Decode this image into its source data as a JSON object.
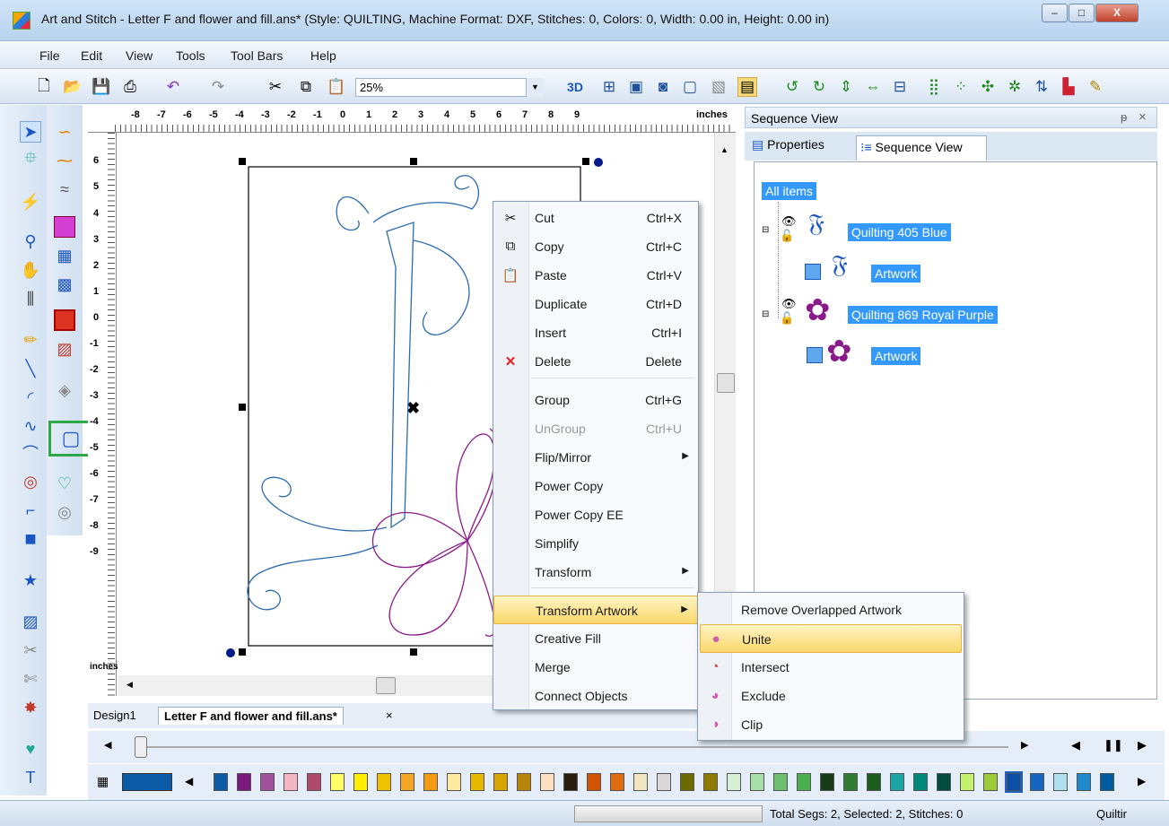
{
  "window": {
    "title": "Art and Stitch - Letter F and flower and fill.ans* (Style: QUILTING, Machine Format: DXF, Stitches: 0, Colors: 0, Width: 0.00 in, Height: 0.00 in)",
    "min": "–",
    "max": "□",
    "close": "X"
  },
  "menubar": [
    "File",
    "Edit",
    "View",
    "Tools",
    "Tool Bars",
    "Help"
  ],
  "toolbar": {
    "zoom": "25%",
    "icons": [
      "new-icon",
      "open-icon",
      "save-icon",
      "print-icon",
      "undo-icon",
      "redo-icon",
      "cut-icon",
      "copy-icon",
      "paste-icon"
    ],
    "btn_3d": "3D"
  },
  "ruler": {
    "top": [
      "-8",
      "-7",
      "-6",
      "-5",
      "-4",
      "-3",
      "-2",
      "-1",
      "0",
      "1",
      "2",
      "3",
      "4",
      "5",
      "6",
      "7",
      "8",
      "9"
    ],
    "unit": "inches",
    "left": [
      "6",
      "5",
      "4",
      "3",
      "2",
      "1",
      "0",
      "-1",
      "-2",
      "-3",
      "-4",
      "-5",
      "-6",
      "-7",
      "-8",
      "-9"
    ],
    "left_unit": "inches"
  },
  "doctabs": [
    "Design1",
    "Letter F and flower and fill.ans*"
  ],
  "doctab_close": "×",
  "sequence": {
    "header": "Sequence View",
    "pin": "ᵽ",
    "close": "×",
    "tabs": [
      "Properties",
      "Sequence View"
    ],
    "tree": [
      "All items",
      "Quilting 405 Blue",
      "Artwork",
      "Quilting 869 Royal Purple",
      "Artwork"
    ]
  },
  "context_menu": [
    {
      "label": "Cut",
      "shortcut": "Ctrl+X",
      "icon": "scissors-icon"
    },
    {
      "label": "Copy",
      "shortcut": "Ctrl+C",
      "icon": "copy-icon"
    },
    {
      "label": "Paste",
      "shortcut": "Ctrl+V",
      "icon": "paste-icon"
    },
    {
      "label": "Duplicate",
      "shortcut": "Ctrl+D"
    },
    {
      "label": "Insert",
      "shortcut": "Ctrl+I"
    },
    {
      "label": "Delete",
      "shortcut": "Delete",
      "icon": "delete-icon"
    },
    {
      "label": "Group",
      "shortcut": "Ctrl+G"
    },
    {
      "label": "UnGroup",
      "shortcut": "Ctrl+U",
      "disabled": true
    },
    {
      "label": "Flip/Mirror",
      "submenu": true
    },
    {
      "label": "Power Copy"
    },
    {
      "label": "Power Copy EE"
    },
    {
      "label": "Simplify"
    },
    {
      "label": "Transform",
      "submenu": true
    },
    {
      "label": "Transform Artwork",
      "submenu": true,
      "highlighted": true
    },
    {
      "label": "Creative Fill"
    },
    {
      "label": "Merge"
    },
    {
      "label": "Connect Objects"
    }
  ],
  "submenu": [
    {
      "label": "Remove Overlapped Artwork"
    },
    {
      "label": "Unite",
      "highlighted": true
    },
    {
      "label": "Intersect"
    },
    {
      "label": "Exclude"
    },
    {
      "label": "Clip"
    }
  ],
  "status": {
    "text": "Total Segs: 2, Selected: 2, Stitches: 0",
    "mode": "Quiltir"
  },
  "palette_colors": [
    "#0b5aa6",
    "#7b1a7b",
    "#a0509c",
    "#f5b5c2",
    "#b04a6a",
    "#ffff66",
    "#ffee00",
    "#f2c200",
    "#f5a623",
    "#f39c12",
    "#ffe8a0",
    "#e6b800",
    "#d9a400",
    "#b8860b",
    "#fde0c0",
    "#2b1d0e",
    "#d35400",
    "#e06a10",
    "#f0e6c0",
    "#d8d8d8",
    "#6b6b00",
    "#8f7a00",
    "#d6f0d6",
    "#a8e0a8",
    "#6cc070",
    "#4caf50",
    "#173b17",
    "#2e7d32",
    "#1b5e20",
    "#1aa5a5",
    "#00897b",
    "#004d40",
    "#c5f26b",
    "#9ccc3a",
    "#0b4fa6",
    "#1565c0",
    "#aee0f0",
    "#1e88c8",
    "#005ba1"
  ]
}
